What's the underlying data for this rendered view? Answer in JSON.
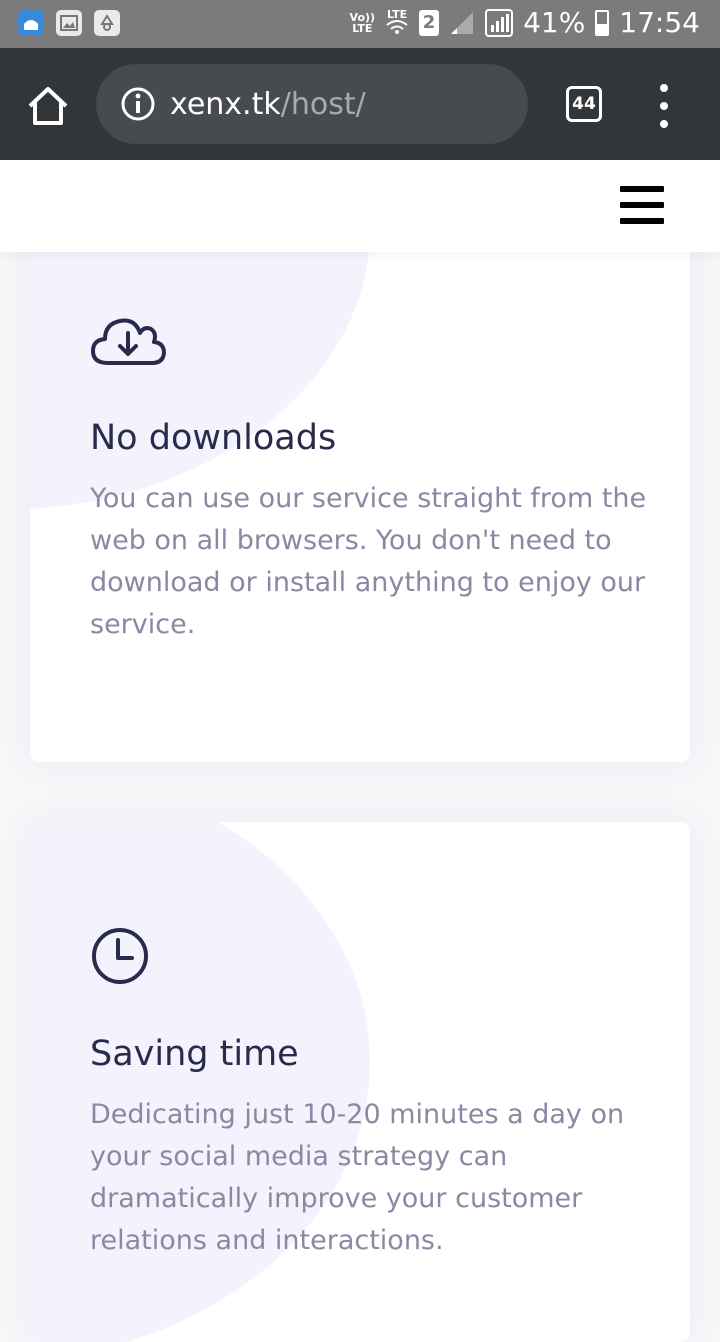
{
  "status_bar": {
    "volte_top": "Vo))",
    "volte_bottom": "LTE",
    "lte_label": "LTE",
    "sim_badge": "2",
    "battery_percent": "41%",
    "battery_level": 0.41,
    "time": "17:54",
    "notification_icons": [
      "app-icon",
      "gallery-icon",
      "recycle-icon"
    ]
  },
  "browser": {
    "url_host": "xenx.tk",
    "url_path": "/host/",
    "tab_count": "44",
    "icons": [
      "home-icon",
      "info-icon",
      "tabs-icon",
      "more-vert-icon"
    ]
  },
  "site_header": {
    "menu_icon": "hamburger-icon"
  },
  "features": [
    {
      "icon": "cloud-download-icon",
      "title": "No downloads",
      "description": "You can use our service straight from the web on all browsers. You don't need to download or install anything to enjoy our service."
    },
    {
      "icon": "clock-icon",
      "title": "Saving time",
      "description": "Dedicating just 10-20 minutes a day on your social media strategy can dramatically improve your customer relations and interactions."
    }
  ],
  "colors": {
    "browser_toolbar": "#323639",
    "url_box": "#474b4f",
    "title": "#2b2a4c",
    "body_text": "#8a89a4",
    "blob": "#f3f3fd"
  }
}
